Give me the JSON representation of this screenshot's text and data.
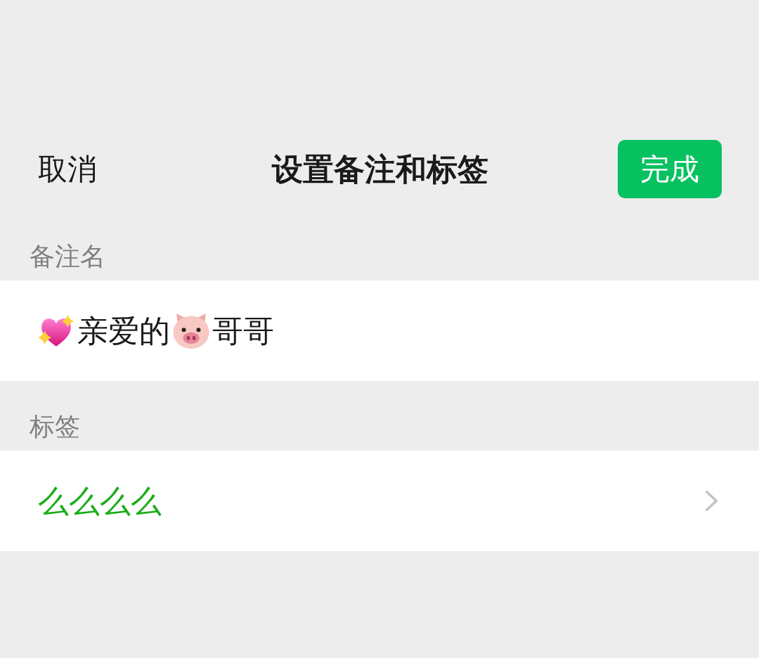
{
  "header": {
    "cancel": "取消",
    "title": "设置备注和标签",
    "done": "完成"
  },
  "remark_name": {
    "label": "备注名",
    "content": [
      {
        "kind": "heart"
      },
      {
        "kind": "text",
        "text": "亲爱的"
      },
      {
        "kind": "pig"
      },
      {
        "kind": "text",
        "text": "哥哥"
      }
    ]
  },
  "tags": {
    "label": "标签",
    "value": "么么么么"
  }
}
